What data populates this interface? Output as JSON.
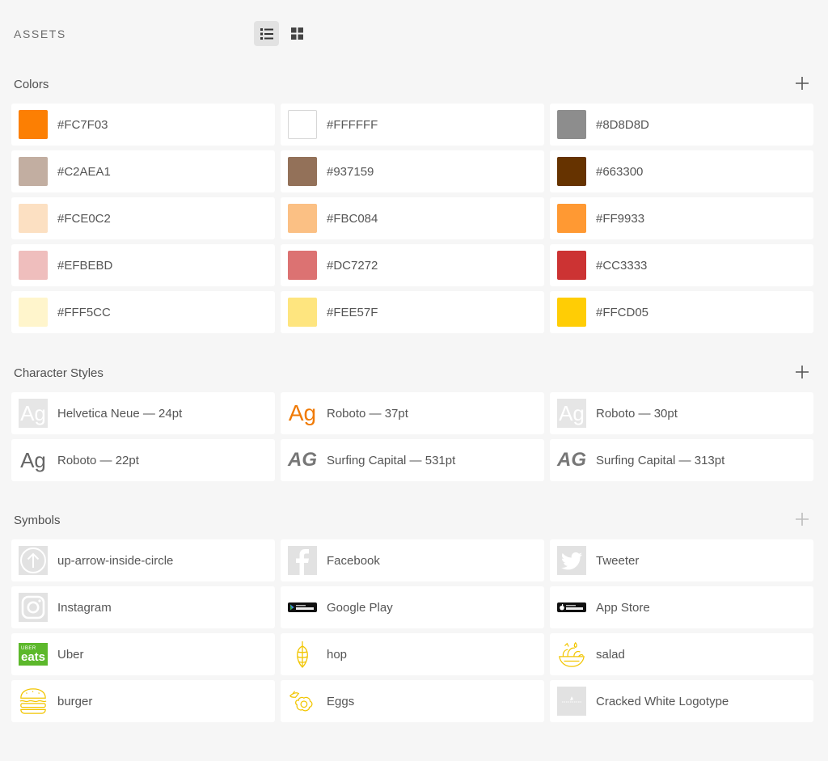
{
  "header": {
    "title": "ASSETS"
  },
  "colors": {
    "title": "Colors",
    "items": [
      {
        "hex": "#FC7F03",
        "label": "#FC7F03"
      },
      {
        "hex": "#FFFFFF",
        "label": "#FFFFFF"
      },
      {
        "hex": "#8D8D8D",
        "label": "#8D8D8D"
      },
      {
        "hex": "#C2AEA1",
        "label": "#C2AEA1"
      },
      {
        "hex": "#937159",
        "label": "#937159"
      },
      {
        "hex": "#663300",
        "label": "#663300"
      },
      {
        "hex": "#FCE0C2",
        "label": "#FCE0C2"
      },
      {
        "hex": "#FBC084",
        "label": "#FBC084"
      },
      {
        "hex": "#FF9933",
        "label": "#FF9933"
      },
      {
        "hex": "#EFBEBD",
        "label": "#EFBEBD"
      },
      {
        "hex": "#DC7272",
        "label": "#DC7272"
      },
      {
        "hex": "#CC3333",
        "label": "#CC3333"
      },
      {
        "hex": "#FFF5CC",
        "label": "#FFF5CC"
      },
      {
        "hex": "#FEE57F",
        "label": "#FEE57F"
      },
      {
        "hex": "#FFCD05",
        "label": "#FFCD05"
      }
    ]
  },
  "character_styles": {
    "title": "Character Styles",
    "preview": "Ag",
    "preview_caps": "AG",
    "items": [
      {
        "label": "Helvetica Neue — 24pt"
      },
      {
        "label": "Roboto — 37pt"
      },
      {
        "label": "Roboto — 30pt"
      },
      {
        "label": "Roboto — 22pt"
      },
      {
        "label": "Surfing Capital — 531pt"
      },
      {
        "label": "Surfing Capital — 313pt"
      }
    ]
  },
  "symbols": {
    "title": "Symbols",
    "items": [
      {
        "label": "up-arrow-inside-circle",
        "icon": "up-arrow-circle-icon"
      },
      {
        "label": "Facebook",
        "icon": "facebook-icon"
      },
      {
        "label": "Tweeter",
        "icon": "twitter-bird-icon"
      },
      {
        "label": "Instagram",
        "icon": "instagram-icon"
      },
      {
        "label": "Google Play",
        "icon": "google-play-badge-icon"
      },
      {
        "label": "App Store",
        "icon": "app-store-badge-icon"
      },
      {
        "label": "Uber",
        "icon": "uber-eats-logo-icon"
      },
      {
        "label": "hop",
        "icon": "hop-icon"
      },
      {
        "label": "salad",
        "icon": "salad-bowl-icon"
      },
      {
        "label": "burger",
        "icon": "burger-icon"
      },
      {
        "label": "Eggs",
        "icon": "fried-egg-icon"
      },
      {
        "label": "Cracked White Logotype",
        "icon": "logotype-thumbnail-icon"
      }
    ]
  },
  "brand": {
    "uber_small": "UBER",
    "uber_big": "eats"
  },
  "icon_colors": {
    "line_icon": "#f2c500",
    "uber_green": "#5cb82b",
    "placeholder": "#e2e2e2"
  }
}
